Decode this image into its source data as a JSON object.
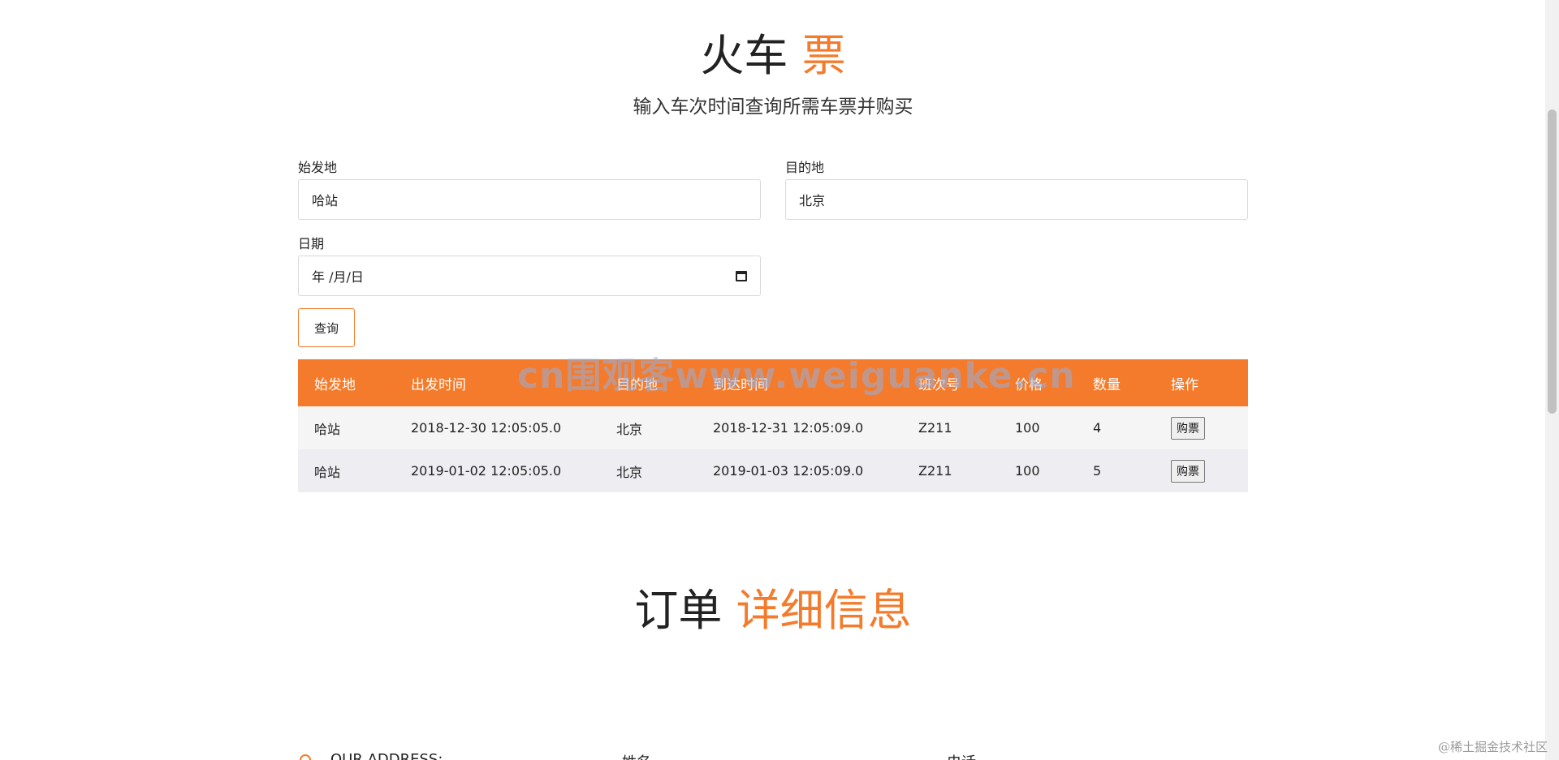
{
  "hero": {
    "title_main": "火车",
    "title_accent": "票",
    "subtitle": "输入车次时间查询所需车票并购买"
  },
  "form": {
    "origin_label": "始发地",
    "origin_value": "哈站",
    "destination_label": "目的地",
    "destination_value": "北京",
    "date_label": "日期",
    "date_placeholder": "年 /月/日",
    "search_label": "查询"
  },
  "table": {
    "headers": [
      "始发地",
      "出发时间",
      "目的地",
      "到达时间",
      "班次号",
      "价格",
      "数量",
      "操作"
    ],
    "rows": [
      {
        "origin": "哈站",
        "depart": "2018-12-30 12:05:05.0",
        "destination": "北京",
        "arrive": "2018-12-31 12:05:09.0",
        "train": "Z211",
        "price": "100",
        "qty": "4",
        "action": "购票"
      },
      {
        "origin": "哈站",
        "depart": "2019-01-02 12:05:05.0",
        "destination": "北京",
        "arrive": "2019-01-03 12:05:09.0",
        "train": "Z211",
        "price": "100",
        "qty": "5",
        "action": "购票"
      }
    ]
  },
  "watermark": "cn围观客www.weiguanke.cn",
  "order": {
    "title_main": "订单",
    "title_accent": "详细信息",
    "address_label": "OUR ADDRESS:",
    "name_label": "姓名",
    "phone_label": "电话"
  },
  "credit": "@稀土掘金技术社区",
  "colors": {
    "accent": "#f47b2b"
  },
  "icons": {
    "date": "calendar-icon",
    "address": "location-icon"
  }
}
